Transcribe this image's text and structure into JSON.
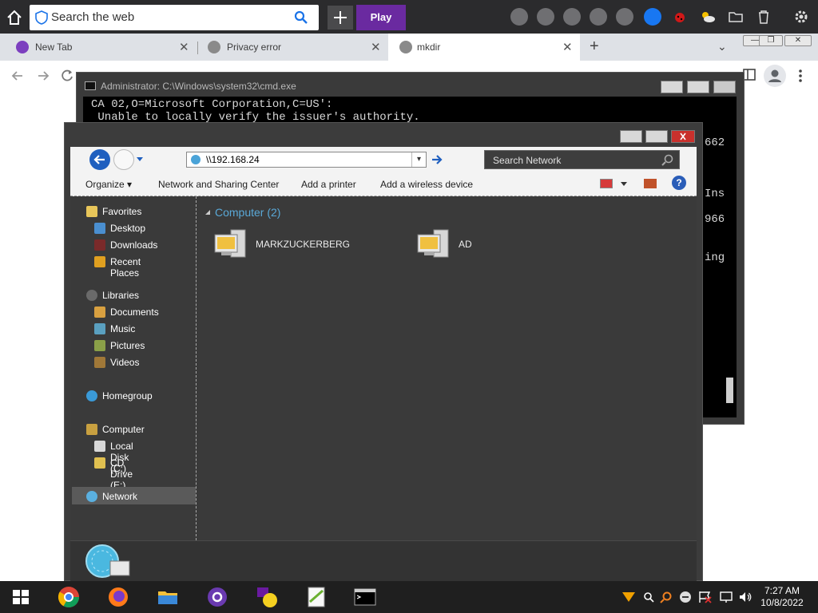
{
  "browser": {
    "search": {
      "placeholder": "Search the web"
    },
    "play_label": "Play",
    "tabs": [
      {
        "label": "New Tab",
        "close": "✕"
      },
      {
        "label": "Privacy error",
        "close": "✕"
      },
      {
        "label": "mkdir",
        "close": "✕"
      }
    ],
    "new_tab": "+",
    "tab_dropdown": "⌄"
  },
  "cmd": {
    "title": "Administrator: C:\\Windows\\system32\\cmd.exe",
    "lines": [
      "CA 02,O=Microsoft Corporation,C=US':",
      " Unable to locally verify the issuer's authority."
    ],
    "right_fragments": [
      "662",
      "Ins",
      "966",
      "ing"
    ]
  },
  "explorer": {
    "address": "\\\\192.168.24",
    "search_placeholder": "Search Network",
    "commands": {
      "organize": "Organize ▾",
      "network_center": "Network and Sharing Center",
      "add_printer": "Add a printer",
      "add_wireless": "Add a wireless device"
    },
    "sidebar": {
      "favorites": "Favorites",
      "desktop": "Desktop",
      "downloads": "Downloads",
      "recent": "Recent Places",
      "libraries": "Libraries",
      "documents": "Documents",
      "music": "Music",
      "pictures": "Pictures",
      "videos": "Videos",
      "homegroup": "Homegroup",
      "computer": "Computer",
      "local_disk": "Local Disk (C:)",
      "cd_drive": "CD Drive (E:)",
      "network": "Network"
    },
    "group_header": "Computer (2)",
    "computers": [
      {
        "name": "MARKZUCKERBERG"
      },
      {
        "name": "AD"
      }
    ]
  },
  "taskbar": {
    "time": "7:27 AM",
    "date": "10/8/2022"
  },
  "colors": {
    "topbar": "#2b2b2d",
    "play": "#6a2aa0",
    "explorer_bg": "#3a3a3a",
    "group_header": "#5aa9d8",
    "taskbar": "#1f1f1f"
  }
}
